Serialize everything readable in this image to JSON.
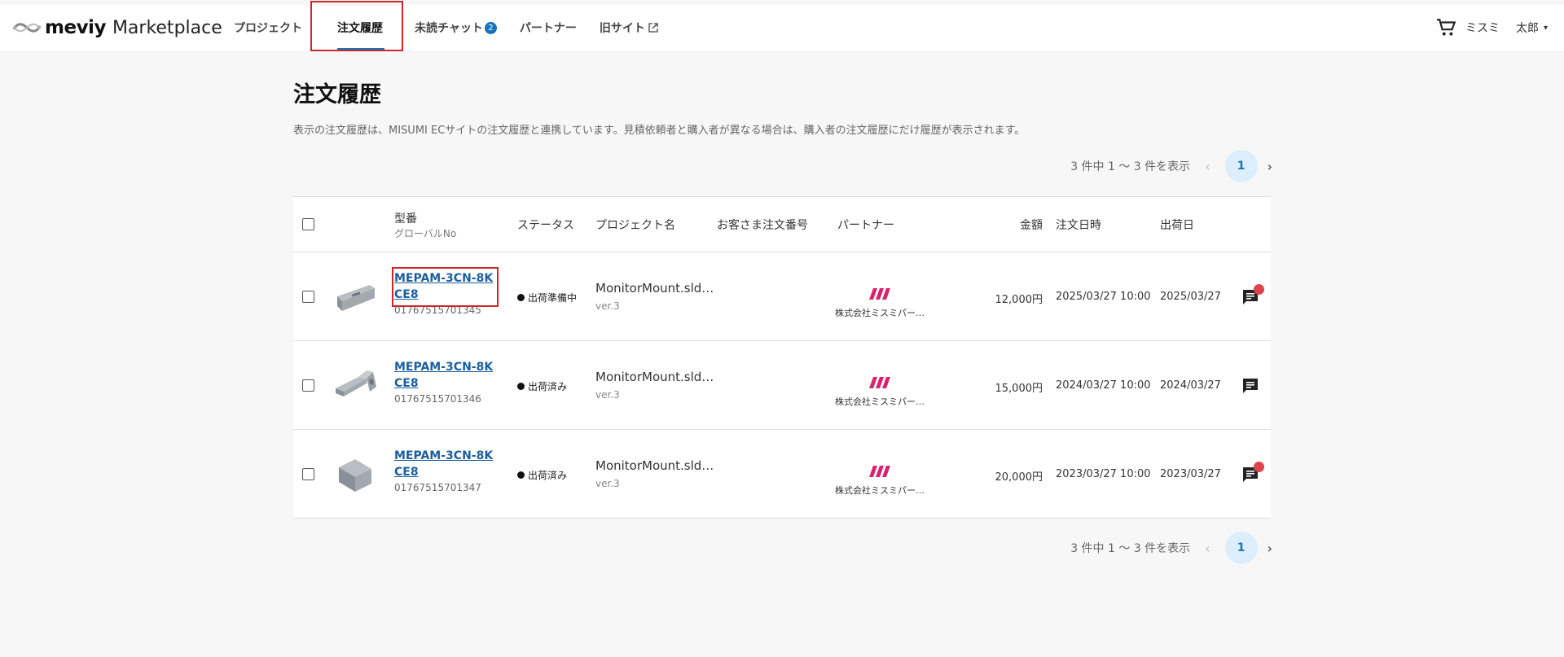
{
  "header": {
    "logo_word": "meviy",
    "logo_sub": "Marketplace",
    "nav": [
      {
        "label": "プロジェクト"
      },
      {
        "label": "注文履歴"
      },
      {
        "label": "未読チャット"
      },
      {
        "label": "パートナー"
      },
      {
        "label": "旧サイト"
      }
    ],
    "unread_count": "2",
    "user_last": "ミスミ",
    "user_first": "太郎",
    "icons": [
      "cart-icon",
      "external-link-icon",
      "chevron-down-icon"
    ]
  },
  "main": {
    "title": "注文履歴",
    "description": "表示の注文履歴は、MISUMI ECサイトの注文履歴と連携しています。見積依頼者と購入者が異なる場合は、購入者の注文履歴にだけ履歴が表示されます。",
    "pager": {
      "range": "3 件中 1 ～ 3 件を表示",
      "page": "1",
      "prev": "‹",
      "next": "›"
    }
  },
  "table": {
    "headers": {
      "part_no": "型番",
      "global_no": "グローバルNo",
      "status": "ステータス",
      "project": "プロジェクト名",
      "customer_order": "お客さま注文番号",
      "partner": "パートナー",
      "amount": "金額",
      "order_date": "注文日時",
      "ship_date": "出荷日"
    },
    "rows": [
      {
        "part_no": "MEPAM-3CN-8KCE8",
        "global_no": "01767515701345",
        "status": "出荷準備中",
        "project": "MonitorMount.sld…",
        "version": "ver.3",
        "partner": "株式会社ミスミパー…",
        "amount": "12,000円",
        "order_date": "2025/03/27 10:00",
        "ship_date": "2025/03/27",
        "unread": true
      },
      {
        "part_no": "MEPAM-3CN-8KCE8",
        "global_no": "01767515701346",
        "status": "出荷済み",
        "project": "MonitorMount.sld…",
        "version": "ver.3",
        "partner": "株式会社ミスミパー…",
        "amount": "15,000円",
        "order_date": "2024/03/27 10:00",
        "ship_date": "2024/03/27",
        "unread": false
      },
      {
        "part_no": "MEPAM-3CN-8KCE8",
        "global_no": "01767515701347",
        "status": "出荷済み",
        "project": "MonitorMount.sld…",
        "version": "ver.3",
        "partner": "株式会社ミスミパー…",
        "amount": "20,000円",
        "order_date": "2023/03/27 10:00",
        "ship_date": "2023/03/27",
        "unread": true
      }
    ]
  },
  "colors": {
    "accent": "#1a73b8",
    "highlight": "#d0242b",
    "partner_logo": "#d6246e",
    "unread": "#e0424b"
  }
}
